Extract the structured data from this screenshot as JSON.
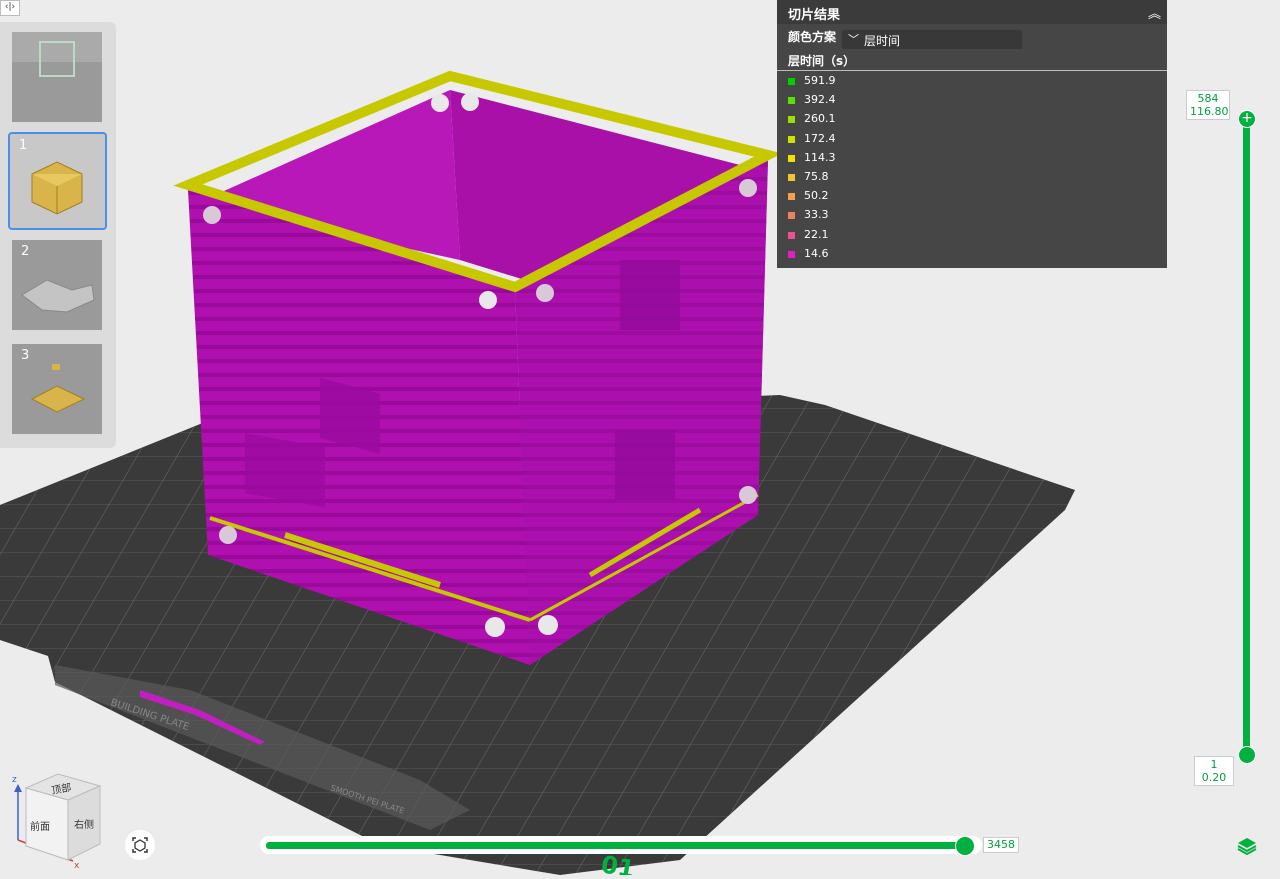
{
  "window": {
    "panel_toggle_icon": "code-panel-icon"
  },
  "plates": [
    {
      "label": ""
    },
    {
      "label": "1",
      "selected": true
    },
    {
      "label": "2"
    },
    {
      "label": "3"
    }
  ],
  "slice_results": {
    "title": "切片结果",
    "collapse_icon": "double-chevron-up-icon",
    "color_scheme_label": "颜色方案",
    "color_scheme_value": "层时间",
    "legend_title": "层时间（s）",
    "legend": [
      {
        "value": "591.9",
        "color": "#00d000"
      },
      {
        "value": "392.4",
        "color": "#5ce000"
      },
      {
        "value": "260.1",
        "color": "#9be000"
      },
      {
        "value": "172.4",
        "color": "#d0e000"
      },
      {
        "value": "114.3",
        "color": "#f0e000"
      },
      {
        "value": "75.8",
        "color": "#f5c230"
      },
      {
        "value": "50.2",
        "color": "#f5a050"
      },
      {
        "value": "33.3",
        "color": "#f08060"
      },
      {
        "value": "22.1",
        "color": "#ee5090"
      },
      {
        "value": "14.6",
        "color": "#e020c0"
      }
    ]
  },
  "layer_slider": {
    "top_layer": "584",
    "top_height": "116.80",
    "bottom_layer": "1",
    "bottom_height": "0.20"
  },
  "move_slider": {
    "value": "3458"
  },
  "view_cube": {
    "top": "顶部",
    "front": "前面",
    "right": "右侧"
  },
  "bed_text": {
    "brand_left": "BUILDING PLATE",
    "brand_right": "SMOOTH PEI PLATE",
    "plate_number": "01"
  },
  "colors": {
    "accent": "#00b140",
    "model_main": "#b010b0",
    "model_edge": "#c8c800",
    "bed": "#3a3a3a"
  }
}
